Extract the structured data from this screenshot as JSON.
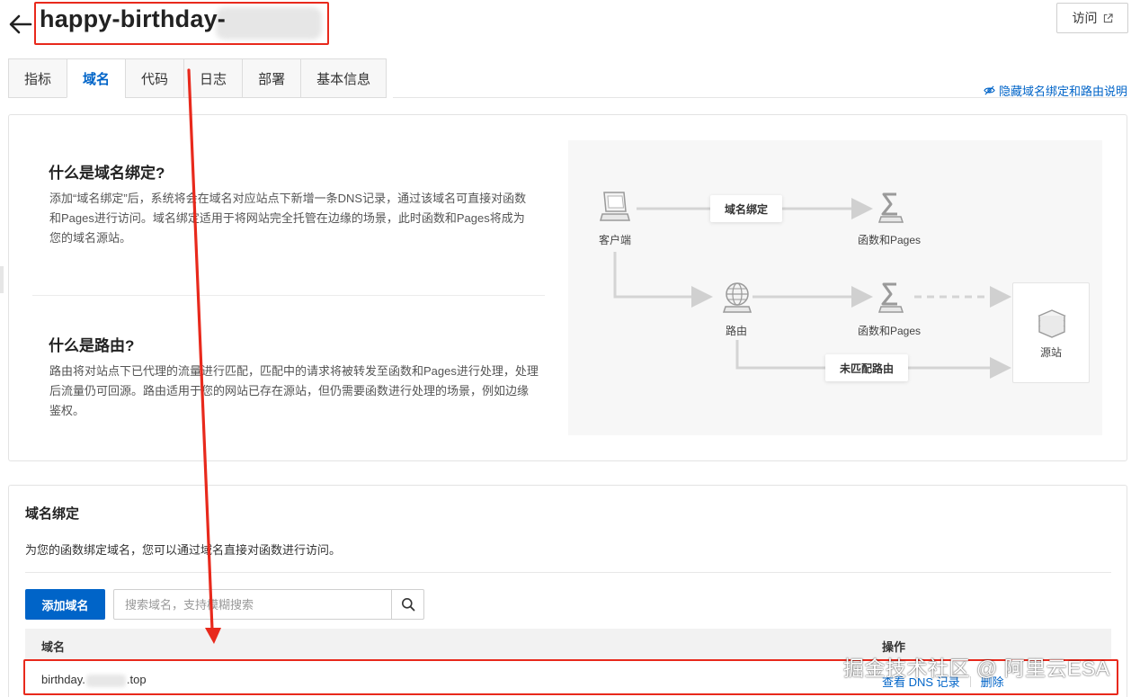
{
  "header": {
    "title": "happy-birthday-",
    "visit_label": "访问"
  },
  "tabs": [
    {
      "label": "指标"
    },
    {
      "label": "域名",
      "active": true
    },
    {
      "label": "代码"
    },
    {
      "label": "日志"
    },
    {
      "label": "部署"
    },
    {
      "label": "基本信息"
    }
  ],
  "hide_link": "隐藏域名绑定和路由说明",
  "info": {
    "domain_binding": {
      "title": "什么是域名绑定?",
      "text": "添加“域名绑定”后，系统将会在域名对应站点下新增一条DNS记录，通过该域名可直接对函数和Pages进行访问。域名绑定适用于将网站完全托管在边缘的场景，此时函数和Pages将成为您的域名源站。"
    },
    "routing": {
      "title": "什么是路由?",
      "text": "路由将对站点下已代理的流量进行匹配，匹配中的请求将被转发至函数和Pages进行处理，处理后流量仍可回源。路由适用于您的网站已存在源站，但仍需要函数进行处理的场景，例如边缘鉴权。"
    }
  },
  "diagram": {
    "client": "客户端",
    "pill_binding": "域名绑定",
    "functions_top": "函数和Pages",
    "route": "路由",
    "functions_mid": "函数和Pages",
    "origin": "源站",
    "pill_unmatched": "未匹配路由"
  },
  "binding": {
    "title": "域名绑定",
    "desc": "为您的函数绑定域名，您可以通过域名直接对函数进行访问。",
    "add_label": "添加域名",
    "search_placeholder": "搜索域名，支持模糊搜索",
    "columns": {
      "domain": "域名",
      "ops": "操作"
    },
    "rows": [
      {
        "domain_prefix": "birthday.",
        "domain_suffix": ".top",
        "view_dns": "查看 DNS 记录",
        "delete": "删除"
      }
    ]
  },
  "watermark": "掘金技术社区 @ 阿里云ESA",
  "colors": {
    "accent": "#0064c8",
    "annotation": "#e8291c"
  }
}
